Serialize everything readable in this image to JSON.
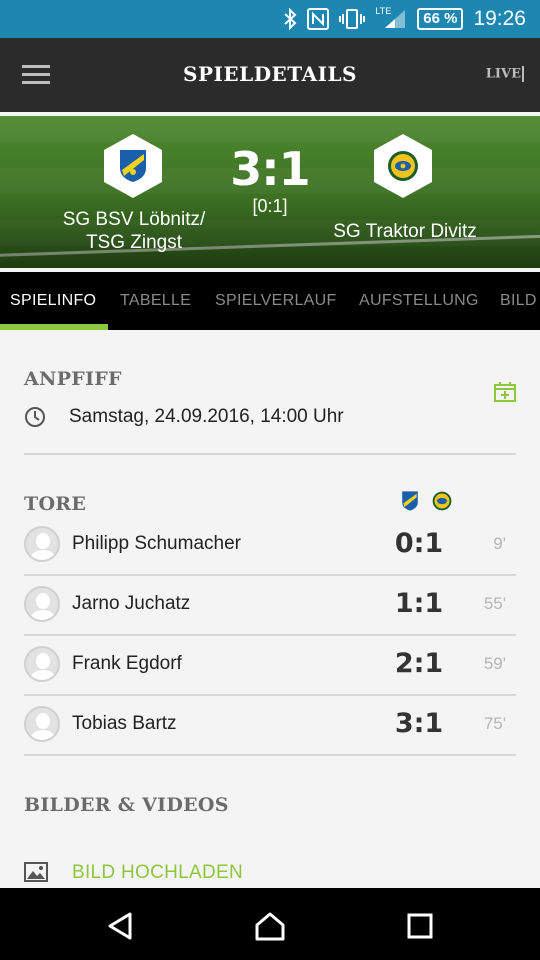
{
  "status_bar": {
    "lte": "LTE",
    "battery": "66 %",
    "time": "19:26"
  },
  "app_bar": {
    "title": "SPIELDETAILS",
    "live_label": "LIVE"
  },
  "match": {
    "home_team": "SG BSV Löbnitz/\nTSG Zingst",
    "away_team": "SG Traktor Divitz",
    "score": "3:1",
    "halftime": "[0:1]"
  },
  "tabs": [
    "SPIELINFO",
    "TABELLE",
    "SPIELVERLAUF",
    "AUFSTELLUNG",
    "BILD"
  ],
  "active_tab": 0,
  "kickoff": {
    "title": "ANPFIFF",
    "datetime": "Samstag, 24.09.2016, 14:00 Uhr"
  },
  "goals": {
    "title": "TORE",
    "rows": [
      {
        "player": "Philipp Schumacher",
        "score": "0:1",
        "minute": "9'"
      },
      {
        "player": "Jarno Juchatz",
        "score": "1:1",
        "minute": "55'"
      },
      {
        "player": "Frank Egdorf",
        "score": "2:1",
        "minute": "59'"
      },
      {
        "player": "Tobias Bartz",
        "score": "3:1",
        "minute": "75'"
      }
    ]
  },
  "media": {
    "title": "BILDER & VIDEOS",
    "upload_label": "BILD HOCHLADEN"
  },
  "colors": {
    "accent": "#8dc63f",
    "status_bar": "#1d87b2",
    "app_bar": "#2b2b2b",
    "tab_bar": "#000000"
  }
}
